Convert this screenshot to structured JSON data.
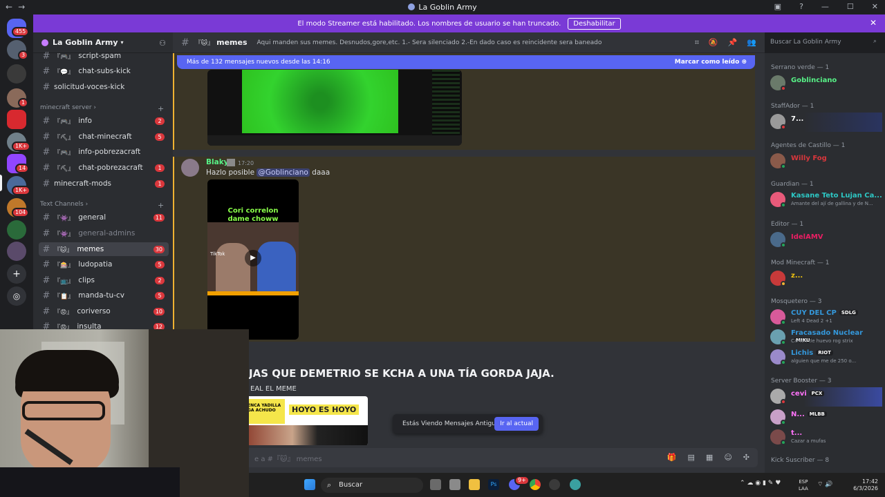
{
  "titlebar": {
    "title": "La Goblin Army",
    "back": "←",
    "forward": "→"
  },
  "banner": {
    "text": "El modo Streamer está habilitado. Los nombres de usuario se han truncado.",
    "button": "Deshabilitar"
  },
  "guilds": {
    "dm_badge": "455",
    "badges": [
      "3",
      "1",
      "1K+",
      "14",
      "1K+",
      "104"
    ]
  },
  "server": {
    "name": "La Goblin Army"
  },
  "channels": {
    "top": [
      {
        "emoji": "『🎮』",
        "name": "script-spam",
        "count": ""
      },
      {
        "emoji": "『💬』",
        "name": "chat-subs-kick",
        "count": ""
      },
      {
        "emoji": "",
        "name": "solicitud-voces-kick",
        "count": ""
      }
    ],
    "cat_minecraft": "minecraft server",
    "minecraft": [
      {
        "emoji": "『🎮』",
        "name": "info",
        "count": "2"
      },
      {
        "emoji": "『⛏』",
        "name": "chat-minecraft",
        "count": "5"
      },
      {
        "emoji": "『🎮』",
        "name": "info-pobrezacraft",
        "count": ""
      },
      {
        "emoji": "『⛏』",
        "name": "chat-pobrezacraft",
        "count": "1"
      },
      {
        "emoji": "",
        "name": "minecraft-mods",
        "count": "1"
      }
    ],
    "cat_text": "Text Channels",
    "text": [
      {
        "emoji": "『👾』",
        "name": "general",
        "count": "11"
      },
      {
        "emoji": "『👾』",
        "name": "general-admins",
        "count": ""
      },
      {
        "emoji": "『🐱』",
        "name": "memes",
        "count": "30"
      },
      {
        "emoji": "『🎰』",
        "name": "ludopatia",
        "count": "5"
      },
      {
        "emoji": "『📺』",
        "name": "clips",
        "count": "2"
      },
      {
        "emoji": "『📋』",
        "name": "manda-tu-cv",
        "count": "5"
      },
      {
        "emoji": "『😡』",
        "name": "coriverso",
        "count": "10"
      },
      {
        "emoji": "『😡』",
        "name": "insulta",
        "count": "12"
      }
    ]
  },
  "header": {
    "channel_emoji": "『🐱』",
    "channel": "memes",
    "topic": "Aqui manden sus memes. Desnudos,gore,etc. 1.- Sera silenciado 2.-En dado caso es reincidente sera baneado",
    "search_placeholder": "Buscar La Goblin Army"
  },
  "chat": {
    "new_messages": "Más de 132 mensajes nuevos desde las 14:16",
    "mark_read": "Marcar como leído",
    "msg1": {
      "user": "Blaky",
      "time": "17:20",
      "text": "Hazlo posible",
      "mention": "@Goblinciano",
      "text2": "daaa",
      "video_caption": "Cori correlon dame choww",
      "tiktok": "TikTok"
    },
    "msg2": {
      "bigtext": "JAS QUE DEMETRIO SE KCHA A UNA TÍA GORDA JAJA.",
      "sub": "EAL EL MEME",
      "meme_left": "ENCA YADILLA GA ACHUDO",
      "meme_right": "HOYO ES HOYO"
    },
    "toast": {
      "text": "Estás Viendo Mensajes Antiguos",
      "button": "Ir al actual"
    }
  },
  "composer": {
    "placeholder": "e a #『🐱』 memes"
  },
  "members": [
    {
      "category": "Serrano verde — 1",
      "users": [
        {
          "name": "Goblinciano",
          "color": "#57f287",
          "status": ""
        }
      ]
    },
    {
      "category": "StaffAdor — 1",
      "users": [
        {
          "name": "7...",
          "color": "#ffffff",
          "status": ""
        }
      ]
    },
    {
      "category": "Agentes de Castillo — 1",
      "users": [
        {
          "name": "Willy Fog",
          "color": "#da373c",
          "status": ""
        }
      ]
    },
    {
      "category": "Guardian — 1",
      "users": [
        {
          "name": "Kasane Teto Lujan Ca...",
          "color": "#2dc7c4",
          "status": "Amante del ají de gallina y de N..."
        }
      ]
    },
    {
      "category": "Editor — 1",
      "users": [
        {
          "name": "IdelAMV",
          "color": "#e91e63",
          "status": ""
        }
      ]
    },
    {
      "category": "Mod Minecraft — 1",
      "users": [
        {
          "name": "z...",
          "color": "#f1c40f",
          "status": ""
        }
      ]
    },
    {
      "category": "Mosquetero — 3",
      "users": [
        {
          "name": "CUY DEL CP",
          "color": "#3498db",
          "status": "Left 4 Dead 2 +1",
          "tag": "SDLG"
        },
        {
          "name": "Fracasado Nuclear",
          "color": "#3498db",
          "status": "Carton de huevo rog strix",
          "tag": "MIKU"
        },
        {
          "name": "Lichis",
          "color": "#3498db",
          "status": "alguien que me de 250 o...",
          "tag": "RIOT"
        }
      ]
    },
    {
      "category": "Server Booster — 3",
      "users": [
        {
          "name": "cevi",
          "color": "#ff73fa",
          "status": "",
          "tag": "PCX"
        },
        {
          "name": "N...",
          "color": "#ff73fa",
          "status": "",
          "tag": "MLBB"
        },
        {
          "name": "t...",
          "color": "#ff73fa",
          "status": "Cazar a mufas"
        }
      ]
    },
    {
      "category": "Kick Suscriber — 8",
      "users": []
    }
  ],
  "taskbar": {
    "search": "Buscar",
    "lang1": "ESP",
    "lang2": "LAA",
    "time": "17:42",
    "date": "6/3/2026",
    "badge": "9+"
  },
  "colors": {
    "accent": "#5865f2",
    "banner": "#7a3ad6",
    "unread": "#da373c",
    "online": "#23a55a"
  }
}
